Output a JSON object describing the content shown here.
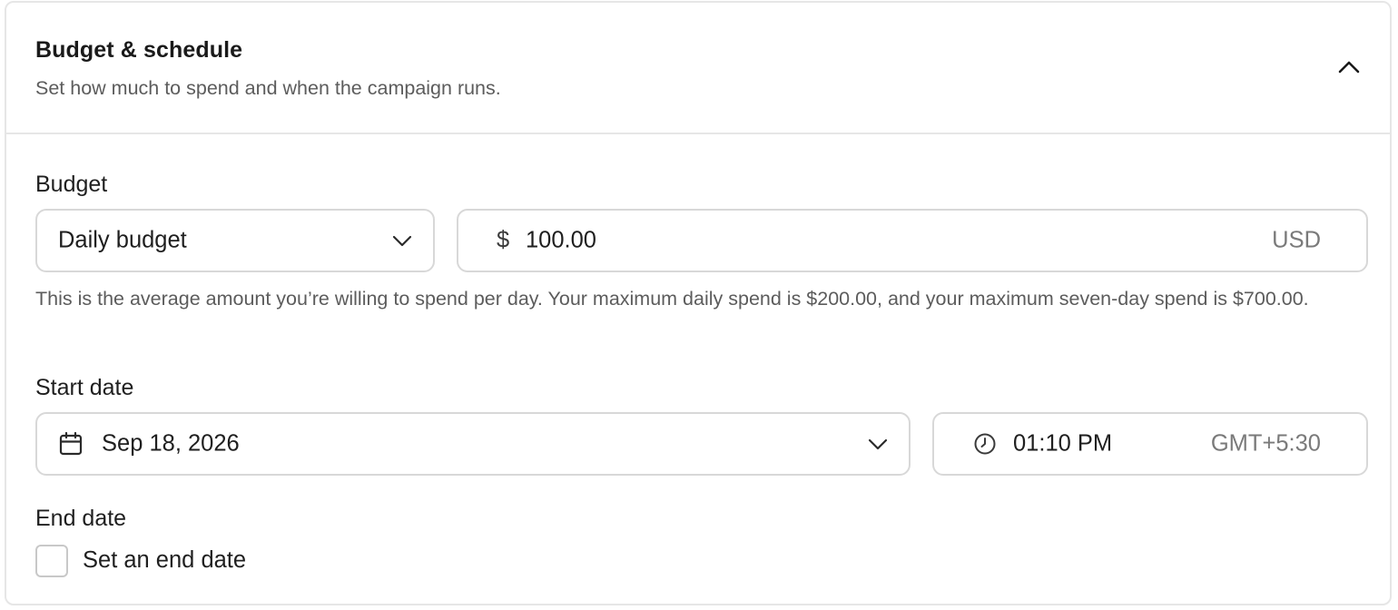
{
  "section": {
    "title": "Budget & schedule",
    "subtitle": "Set how much to spend and when the campaign runs.",
    "toggle_icon": "chevron-up-icon"
  },
  "budget": {
    "label": "Budget",
    "type_selected": "Daily budget",
    "currency_symbol": "$",
    "amount": "100.00",
    "currency_code": "USD",
    "helper": "This is the average amount you’re willing to spend per day. Your maximum daily spend is $200.00, and your maximum seven-day spend is $700.00."
  },
  "start_date": {
    "label": "Start date",
    "date": "Sep 18, 2026",
    "time": "01:10 PM",
    "timezone": "GMT+5:30",
    "date_icon": "calendar-icon",
    "time_icon": "clock-icon"
  },
  "end_date": {
    "label": "End date",
    "checkbox_label": "Set an end date",
    "checked": false
  },
  "colors": {
    "border": "#d8d8d8",
    "divider": "#e6e6e6",
    "text": "#1f1f1f",
    "muted": "#5c5c5c"
  }
}
